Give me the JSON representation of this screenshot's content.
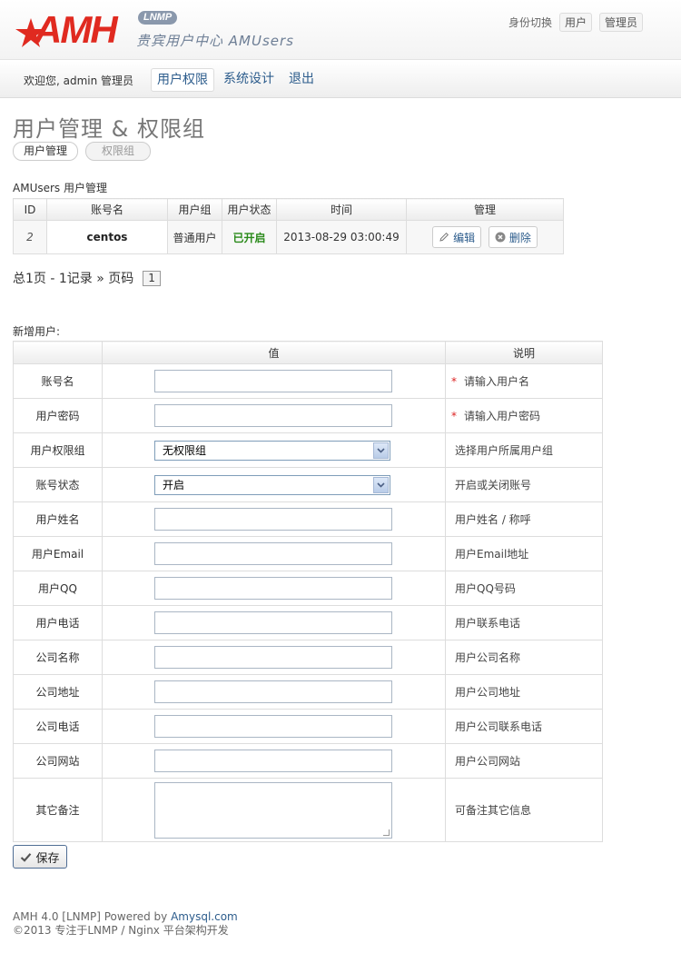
{
  "header": {
    "logo_text": "AMH",
    "logo_badge": "LNMP",
    "subtitle": "贵宾用户中心 AMUsers",
    "identity_label": "身份切换",
    "identity_options": [
      "用户",
      "管理员"
    ]
  },
  "nav": {
    "welcome": "欢迎您, admin 管理员",
    "items": [
      "用户权限",
      "系统设计",
      "退出"
    ]
  },
  "page": {
    "title": "用户管理 & 权限组",
    "tabs": [
      "用户管理",
      "权限组"
    ]
  },
  "users_section": {
    "label": "AMUsers 用户管理",
    "columns": [
      "ID",
      "账号名",
      "用户组",
      "用户状态",
      "时间",
      "管理"
    ],
    "rows": [
      {
        "id": "2",
        "name": "centos",
        "group": "普通用户",
        "status": "已开启",
        "time": "2013-08-29 03:00:49",
        "edit": "编辑",
        "delete": "删除"
      }
    ]
  },
  "pager": {
    "summary": "总1页 - 1记录 » 页码",
    "current": "1"
  },
  "new_user": {
    "label": "新增用户:",
    "columns": [
      "",
      "值",
      "说明"
    ],
    "fields": [
      {
        "label": "账号名",
        "type": "text",
        "desc": "请输入用户名",
        "required": true
      },
      {
        "label": "用户密码",
        "type": "text",
        "desc": "请输入用户密码",
        "required": true
      },
      {
        "label": "用户权限组",
        "type": "select",
        "value": "无权限组",
        "desc": "选择用户所属用户组"
      },
      {
        "label": "账号状态",
        "type": "select",
        "value": "开启",
        "desc": "开启或关闭账号"
      },
      {
        "label": "用户姓名",
        "type": "text",
        "desc": "用户姓名 / 称呼"
      },
      {
        "label": "用户Email",
        "type": "text",
        "desc": "用户Email地址"
      },
      {
        "label": "用户QQ",
        "type": "text",
        "desc": "用户QQ号码"
      },
      {
        "label": "用户电话",
        "type": "text",
        "desc": "用户联系电话"
      },
      {
        "label": "公司名称",
        "type": "text",
        "desc": "用户公司名称"
      },
      {
        "label": "公司地址",
        "type": "text",
        "desc": "用户公司地址"
      },
      {
        "label": "公司电话",
        "type": "text",
        "desc": "用户公司联系电话"
      },
      {
        "label": "公司网站",
        "type": "text",
        "desc": "用户公司网站"
      },
      {
        "label": "其它备注",
        "type": "textarea",
        "desc": "可备注其它信息"
      }
    ],
    "save_label": "保存"
  },
  "footer": {
    "line1_prefix": "AMH 4.0 [LNMP] Powered by ",
    "line1_link": "Amysql.com",
    "line2": "©2013 专注于LNMP / Nginx 平台架构开发"
  },
  "colors": {
    "brand_red": "#e02a20",
    "link_blue": "#2c5c8c",
    "status_green": "#2a8a1a"
  }
}
